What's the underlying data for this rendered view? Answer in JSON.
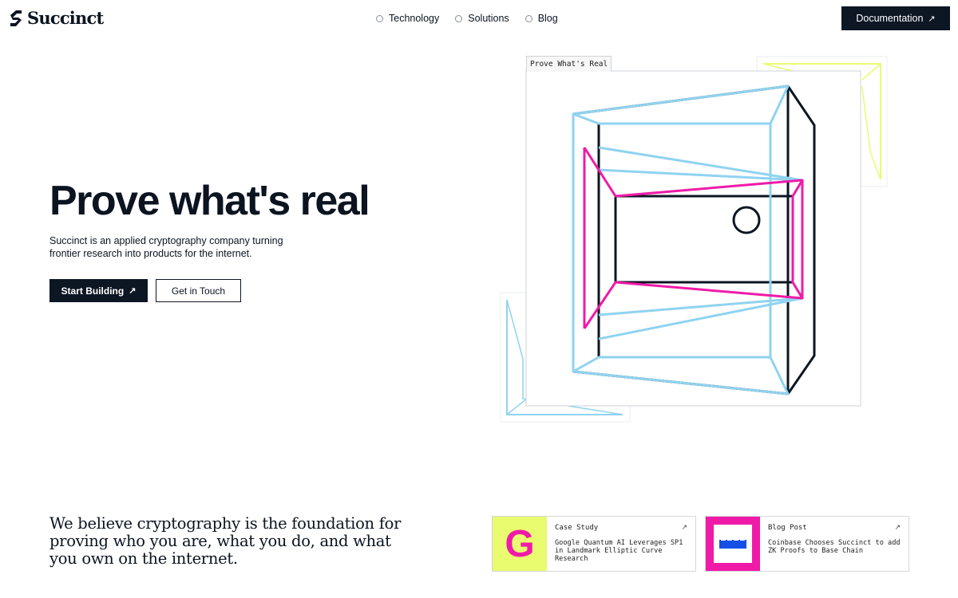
{
  "brand": {
    "name": "Succinct"
  },
  "nav": {
    "items": [
      {
        "label": "Technology"
      },
      {
        "label": "Solutions"
      },
      {
        "label": "Blog"
      }
    ],
    "documentation_label": "Documentation"
  },
  "hero": {
    "title": "Prove what's real",
    "subtitle": "Succinct is an applied cryptography company turning frontier research into products for the internet.",
    "primary_button": "Start Building",
    "secondary_button": "Get in Touch",
    "illustration_tab": "Prove What's Real"
  },
  "belief": {
    "text": "We believe cryptography is the foundation for proving who you are, what you do, and what you own on the internet."
  },
  "cards": [
    {
      "kind": "Case Study",
      "text": "Google Quantum AI Leverages SP1 in Landmark Elliptic Curve Research",
      "thumb_letter": "G"
    },
    {
      "kind": "Blog Post",
      "text": "Coinbase Chooses Succinct to add ZK Proofs to Base Chain"
    }
  ],
  "colors": {
    "navy": "#0d1623",
    "light_blue": "#8fd3f0",
    "magenta": "#f01aa8",
    "lime": "#e9fb6e",
    "pink_bg": "#f01aa8",
    "blue_logo": "#1450e6"
  },
  "icons": {
    "external_link": "↗"
  }
}
